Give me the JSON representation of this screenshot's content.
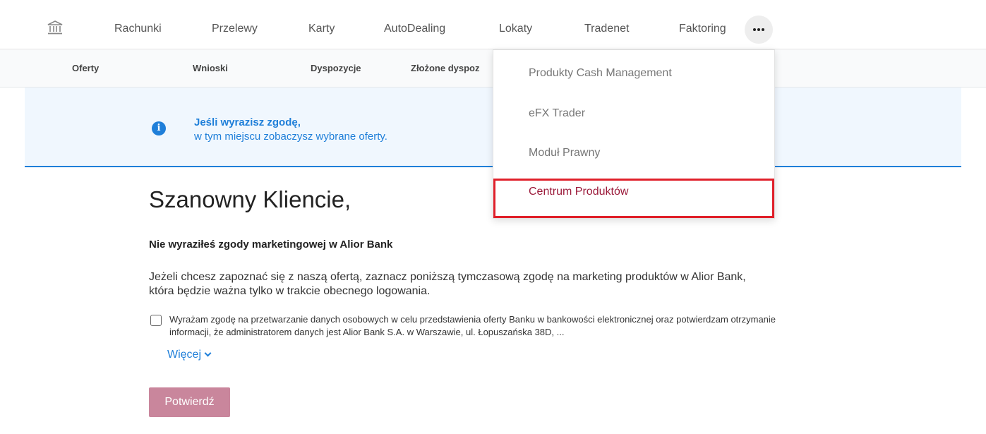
{
  "topnav": {
    "home_icon": "bank-icon",
    "items": [
      "Rachunki",
      "Przelewy",
      "Karty",
      "AutoDealing",
      "Lokaty",
      "Tradenet",
      "Faktoring"
    ],
    "more_icon": "more-horizontal-icon"
  },
  "subnav": {
    "items": [
      "Oferty",
      "Wnioski",
      "Dyspozycje",
      "Złożone dyspoz"
    ]
  },
  "banner": {
    "icon": "info-icon",
    "title": "Jeśli wyrazisz zgodę,",
    "subtitle": "w tym miejscu zobaczysz wybrane oferty."
  },
  "main": {
    "heading": "Szanowny Kliencie,",
    "consent_title": "Nie wyraziłeś zgody marketingowej w Alior Bank",
    "paragraph": "Jeżeli chcesz zapoznać się z naszą ofertą, zaznacz poniższą tymczasową zgodę na marketing produktów w Alior Bank, która będzie ważna tylko w trakcie obecnego logowania.",
    "checkbox_label": "Wyrażam zgodę na przetwarzanie danych osobowych w celu przedstawienia oferty Banku w bankowości elektronicznej oraz potwierdzam otrzymanie informacji, że administratorem danych jest Alior Bank S.A. w Warszawie, ul. Łopuszańska 38D, ...",
    "more_link": "Więcej",
    "confirm_button": "Potwierdź"
  },
  "dropdown": {
    "items": [
      "Produkty Cash Management",
      "eFX Trader",
      "Moduł Prawny",
      "Centrum Produktów"
    ],
    "highlighted_index": 3
  },
  "colors": {
    "accent_blue": "#1f7fd9",
    "banner_bg": "#f0f7fe",
    "button_disabled": "#c9869c",
    "active_item": "#9b1a3a",
    "highlight_border": "#e0202a"
  }
}
